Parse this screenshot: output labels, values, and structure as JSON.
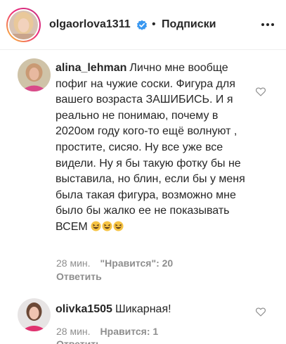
{
  "header": {
    "username": "olgaorlova1311",
    "separator": "•",
    "follow_label": "Подписки"
  },
  "comments": [
    {
      "username": "alina_lehman",
      "text": "Лично мне вообще пофиг на чужие соски. Фигура для вашего возраста ЗАШИБИСЬ. И я реально не понимаю, почему в 2020ом году кого-то ещё волнуют , простите, сисяо. Ну все уже все видели. Ну я бы такую фотку бы не выставила, но блин, если бы у меня была такая фигура, возможно мне было бы жалко ее не показывать ВСЕМ",
      "emoji_count": 3,
      "time": "28 мин.",
      "likes": "\"Нравится\": 20",
      "reply": "Ответить"
    },
    {
      "username": "olivka1505",
      "text": "Шикарная!",
      "time": "28 мин.",
      "likes": "Нравится: 1",
      "reply": "Ответить"
    }
  ],
  "colors": {
    "text": "#262626",
    "meta": "#8e8e8e",
    "verified": "#3897f0",
    "divider": "#efefef"
  },
  "icons": [
    "verified-badge-icon",
    "more-options-icon",
    "heart-icon",
    "grinning-squint-emoji-icon"
  ]
}
